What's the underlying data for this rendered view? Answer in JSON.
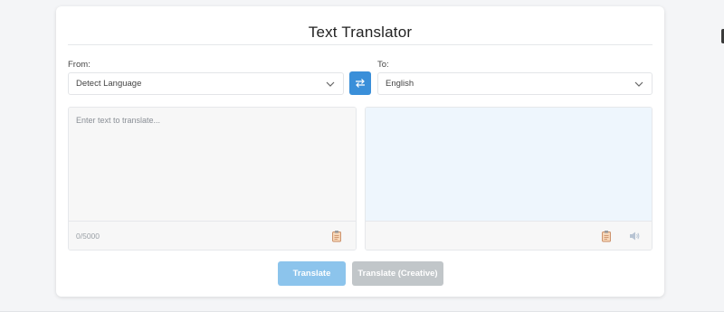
{
  "app": {
    "title": "Text Translator"
  },
  "from": {
    "label": "From:",
    "selected": "Detect Language"
  },
  "to": {
    "label": "To:",
    "selected": "English"
  },
  "source": {
    "placeholder": "Enter text to translate...",
    "value": "",
    "char_count": "0/5000"
  },
  "actions": {
    "translate_label": "Translate",
    "translate_creative_label": "Translate (Creative)"
  },
  "colors": {
    "accent": "#3a8fd9",
    "translate_button": "#8cc4ec",
    "creative_button": "#c1c6c9",
    "output_background": "#eef6fd"
  },
  "icons": {
    "swap": "swap-arrows-icon",
    "copy": "clipboard-icon",
    "speak": "speaker-icon",
    "dropdown": "chevron-down-icon"
  }
}
